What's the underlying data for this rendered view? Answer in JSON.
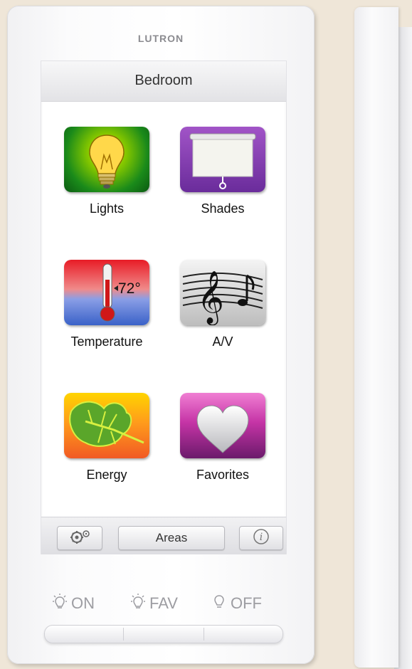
{
  "device": {
    "brand": "LUTRON",
    "screen_title": "Bedroom"
  },
  "tiles": [
    {
      "label": "Lights",
      "icon": "lightbulb-icon"
    },
    {
      "label": "Shades",
      "icon": "window-shade-icon"
    },
    {
      "label": "Temperature",
      "icon": "thermometer-icon",
      "reading": "72°"
    },
    {
      "label": "A/V",
      "icon": "music-notes-icon"
    },
    {
      "label": "Energy",
      "icon": "leaf-icon"
    },
    {
      "label": "Favorites",
      "icon": "heart-icon"
    }
  ],
  "toolbar": {
    "settings_icon": "gears-icon",
    "areas_label": "Areas",
    "info_icon": "info-icon"
  },
  "hardware_buttons": [
    {
      "label": "ON",
      "icon": "bulb-on-icon"
    },
    {
      "label": "FAV",
      "icon": "bulb-fav-icon"
    },
    {
      "label": "OFF",
      "icon": "bulb-off-icon"
    }
  ]
}
